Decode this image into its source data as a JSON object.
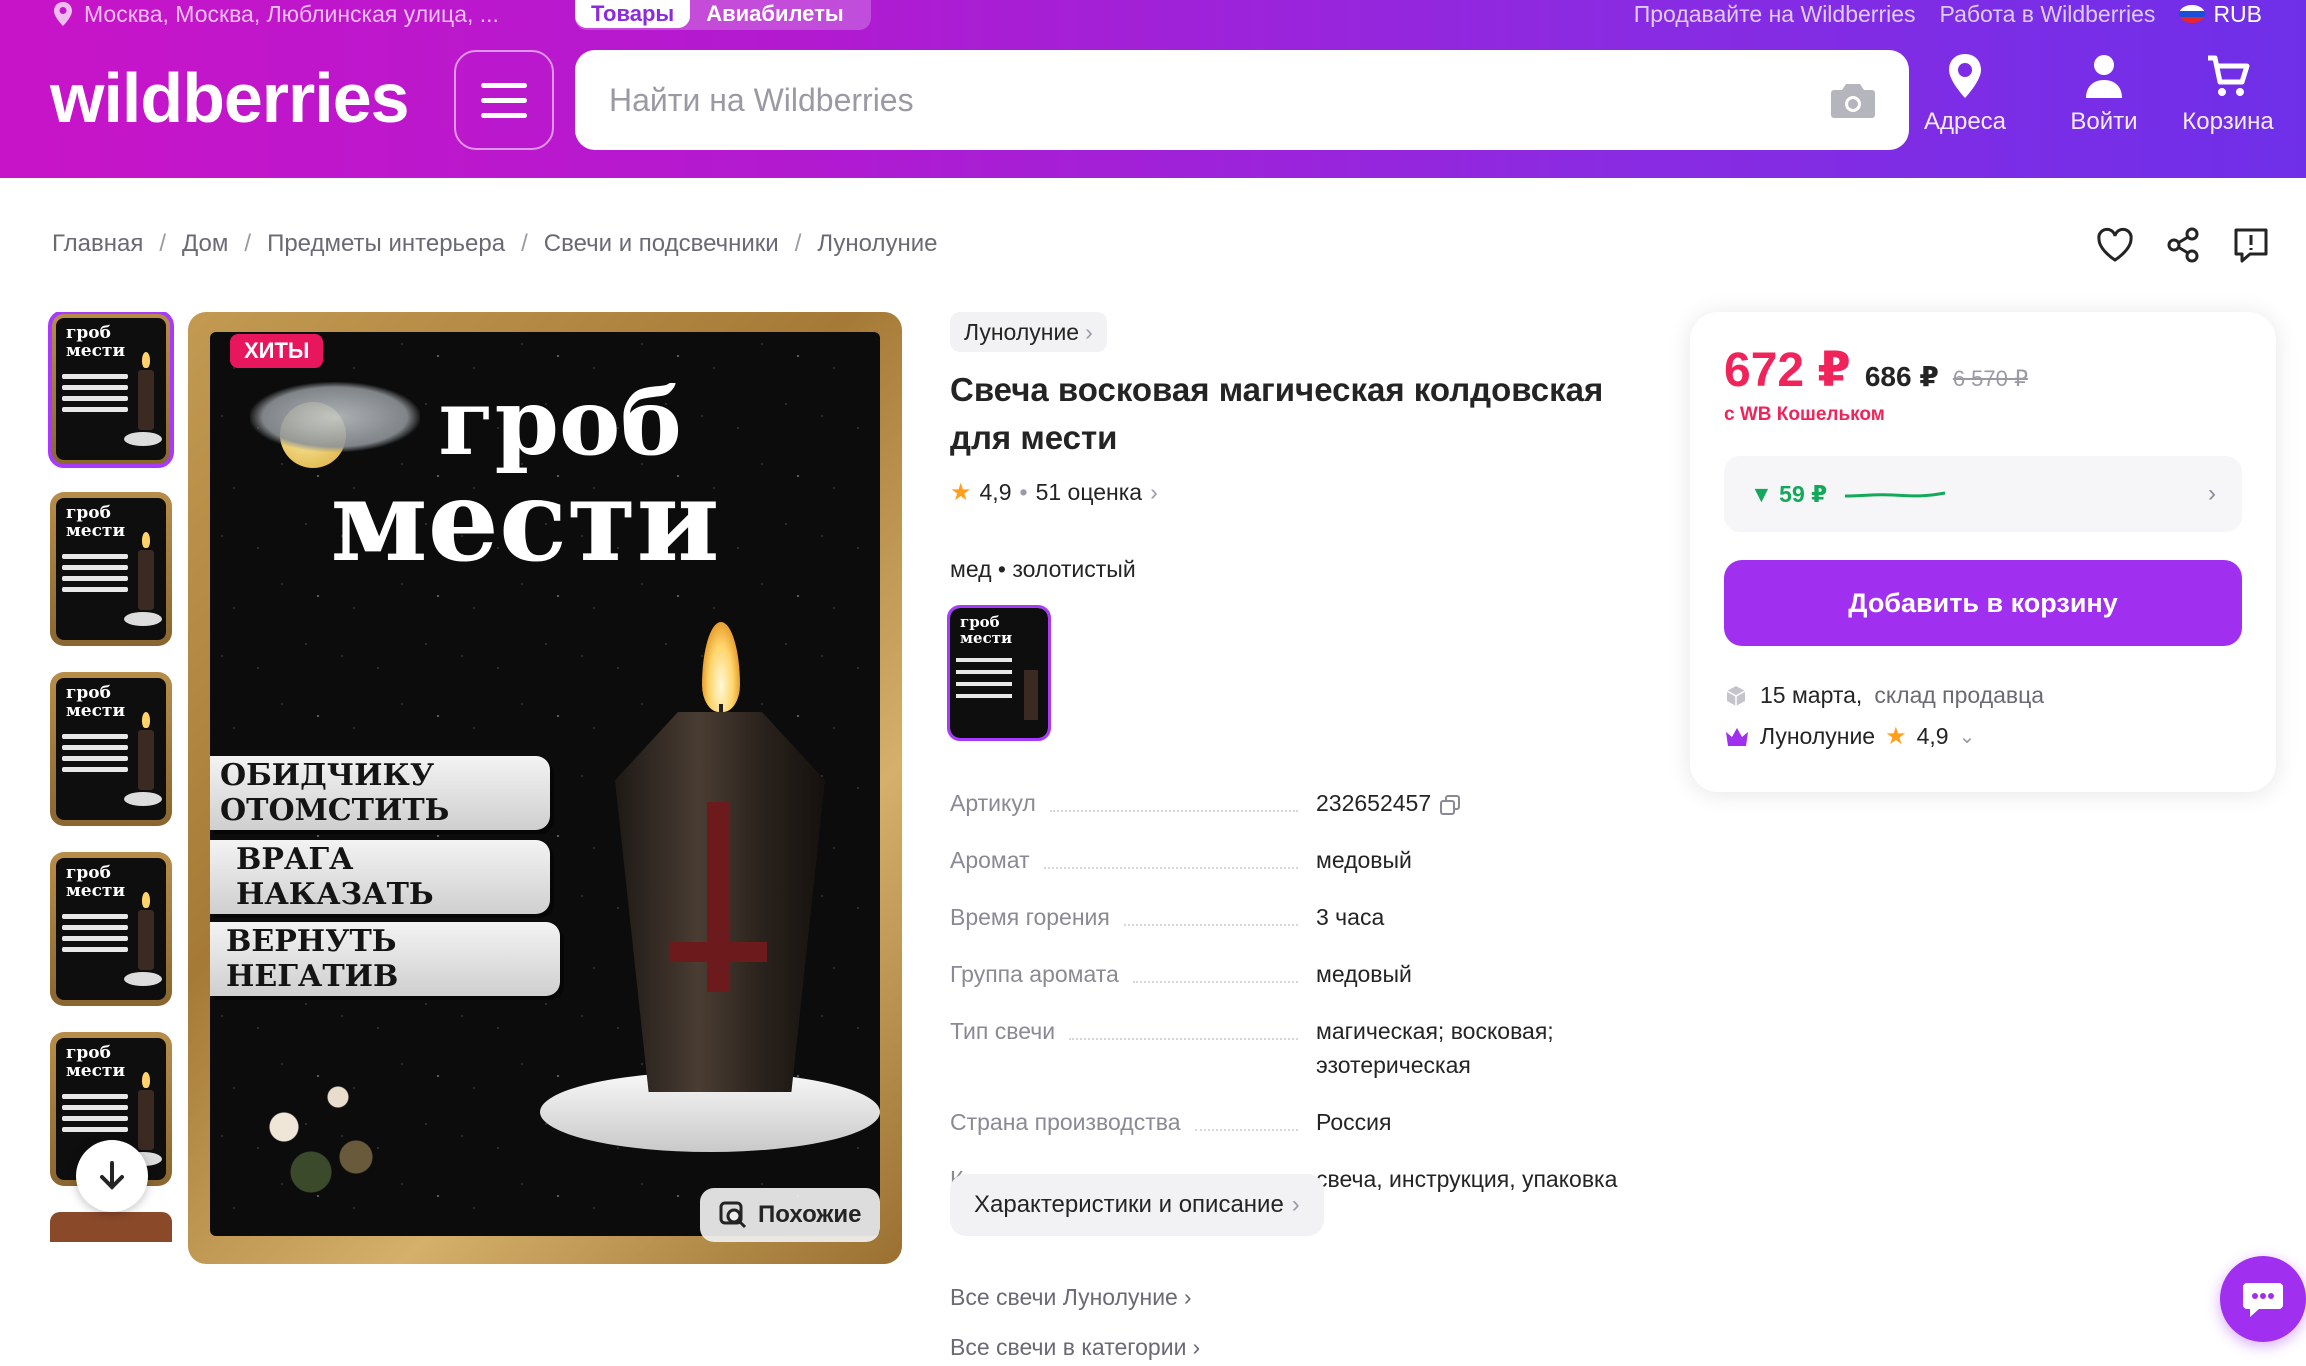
{
  "header": {
    "location": "Москва, Москва, Люблинская улица, ...",
    "toggle": [
      "Товары",
      "Авиабилеты"
    ],
    "sell_link": "Продавайте на Wildberries",
    "work_link": "Работа в Wildberries",
    "currency": "RUB",
    "logo": "wildberries",
    "search_placeholder": "Найти на Wildberries",
    "nav": {
      "addresses": "Адреса",
      "login": "Войти",
      "cart": "Корзина"
    }
  },
  "breadcrumbs": [
    "Главная",
    "Дом",
    "Предметы интерьера",
    "Свечи и подсвечники",
    "Лунолуние"
  ],
  "gallery": {
    "badge": "ХИТЫ",
    "image_title_line1": "гроб",
    "image_title_line2": "мести",
    "image_pills": [
      "ОБИДЧИКУ ОТОМСТИТЬ",
      "ВРАГА НАКАЗАТЬ",
      "ВЕРНУТЬ НЕГАТИВ"
    ],
    "similar_button": "Похожие",
    "thumb_title_line1": "гроб",
    "thumb_title_line2": "мести"
  },
  "product": {
    "brand": "Лунолуние",
    "title": "Свеча восковая магическая колдовская для мести",
    "rating": "4,9",
    "reviews": "51 оценка",
    "variant": "мед • золотистый",
    "specs": [
      {
        "key": "Артикул",
        "value": "232652457"
      },
      {
        "key": "Аромат",
        "value": "медовый"
      },
      {
        "key": "Время горения",
        "value": "3 часа"
      },
      {
        "key": "Группа аромата",
        "value": "медовый"
      },
      {
        "key": "Тип свечи",
        "value": "магическая; восковая; эзотерическая"
      },
      {
        "key": "Страна производства",
        "value": "Россия"
      },
      {
        "key": "Комплектация",
        "value": "свеча, инструкция, упаковка"
      }
    ],
    "description_button": "Характеристики и описание",
    "link_brand": "Все свечи Лунолуние",
    "link_category": "Все свечи в категории"
  },
  "price_card": {
    "price": "672 ₽",
    "price_base": "686 ₽",
    "price_old": "6 570 ₽",
    "wallet_note": "с WB Кошельком",
    "price_drop": "▼ 59 ₽",
    "add_to_cart": "Добавить в корзину",
    "delivery_date": "15 марта,",
    "delivery_source": "склад продавца",
    "seller": "Лунолуние",
    "seller_rating": "4,9"
  },
  "colors": {
    "accent": "#a02ff0",
    "price": "#f0245a",
    "drop": "#14a95a"
  }
}
